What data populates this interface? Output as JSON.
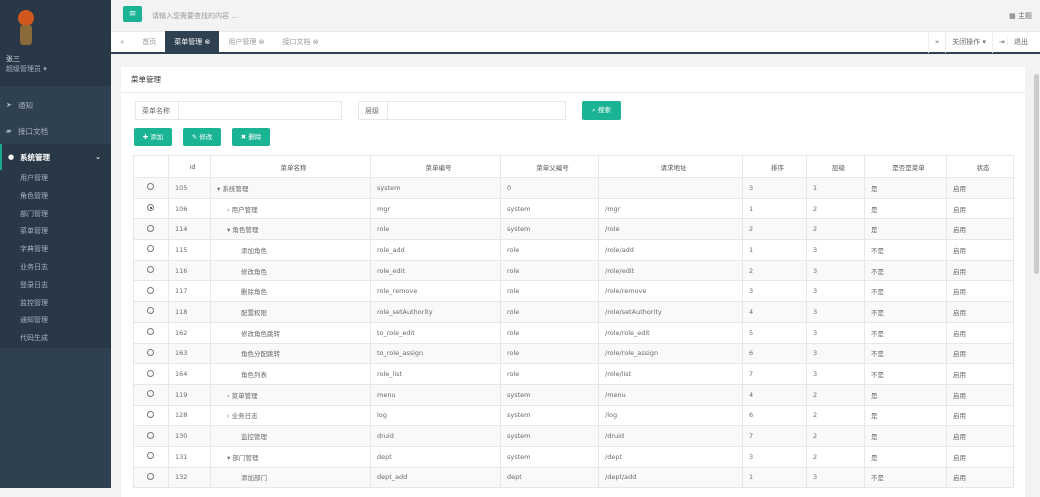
{
  "user": {
    "name": "张三",
    "role": "超级管理员 ▾"
  },
  "sidebar": {
    "items": [
      {
        "icon": "paper-plane-icon",
        "label": "通知"
      },
      {
        "icon": "book-icon",
        "label": "接口文档"
      },
      {
        "icon": "user-icon",
        "label": "系统管理"
      }
    ],
    "sub": [
      "用户管理",
      "角色管理",
      "部门管理",
      "菜单管理",
      "字典管理",
      "业务日志",
      "登录日志",
      "监控管理",
      "通知管理",
      "代码生成"
    ]
  },
  "header": {
    "search_placeholder": "请输入您需要查找的内容 …",
    "theme": "主题"
  },
  "tabs": {
    "home": "首页",
    "items": [
      "菜单管理",
      "用户管理",
      "接口文档"
    ],
    "close_ops": "关闭操作 ▾",
    "logout": "退出"
  },
  "panel": {
    "title": "菜单管理",
    "name_label": "菜单名称",
    "level_label": "层级",
    "search": "搜索",
    "add": "添加",
    "edit": "修改",
    "delete": "删除"
  },
  "table": {
    "headers": [
      "",
      "id",
      "菜单名称",
      "菜单编号",
      "菜单父编号",
      "请求地址",
      "排序",
      "层级",
      "是否是菜单",
      "状态"
    ],
    "rows": [
      [
        "105",
        "▾ 系统管理",
        "system",
        "0",
        "",
        "3",
        "1",
        "是",
        "启用",
        false
      ],
      [
        "106",
        "  › 用户管理",
        "mgr",
        "system",
        "/mgr",
        "1",
        "2",
        "是",
        "启用",
        true
      ],
      [
        "114",
        "  ▾ 角色管理",
        "role",
        "system",
        "/role",
        "2",
        "2",
        "是",
        "启用",
        false
      ],
      [
        "115",
        "添加角色",
        "role_add",
        "role",
        "/role/add",
        "1",
        "3",
        "不是",
        "启用",
        false
      ],
      [
        "116",
        "修改角色",
        "role_edit",
        "role",
        "/role/edit",
        "2",
        "3",
        "不是",
        "启用",
        false
      ],
      [
        "117",
        "删除角色",
        "role_remove",
        "role",
        "/role/remove",
        "3",
        "3",
        "不是",
        "启用",
        false
      ],
      [
        "118",
        "配置权限",
        "role_setAuthority",
        "role",
        "/role/setAuthority",
        "4",
        "3",
        "不是",
        "启用",
        false
      ],
      [
        "162",
        "修改角色跳转",
        "to_role_edit",
        "role",
        "/role/role_edit",
        "5",
        "3",
        "不是",
        "启用",
        false
      ],
      [
        "163",
        "角色分配跳转",
        "to_role_assign",
        "role",
        "/role/role_assign",
        "6",
        "3",
        "不是",
        "启用",
        false
      ],
      [
        "164",
        "角色列表",
        "role_list",
        "role",
        "/role/list",
        "7",
        "3",
        "不是",
        "启用",
        false
      ],
      [
        "119",
        "  › 菜单管理",
        "menu",
        "system",
        "/menu",
        "4",
        "2",
        "是",
        "启用",
        false
      ],
      [
        "128",
        "  › 业务日志",
        "log",
        "system",
        "/log",
        "6",
        "2",
        "是",
        "启用",
        false
      ],
      [
        "130",
        "监控管理",
        "druid",
        "system",
        "/druid",
        "7",
        "2",
        "是",
        "启用",
        false
      ],
      [
        "131",
        "  ▾ 部门管理",
        "dept",
        "system",
        "/dept",
        "3",
        "2",
        "是",
        "启用",
        false
      ],
      [
        "132",
        "添加部门",
        "dept_add",
        "dept",
        "/dept/add",
        "1",
        "3",
        "不是",
        "启用",
        false
      ]
    ]
  }
}
